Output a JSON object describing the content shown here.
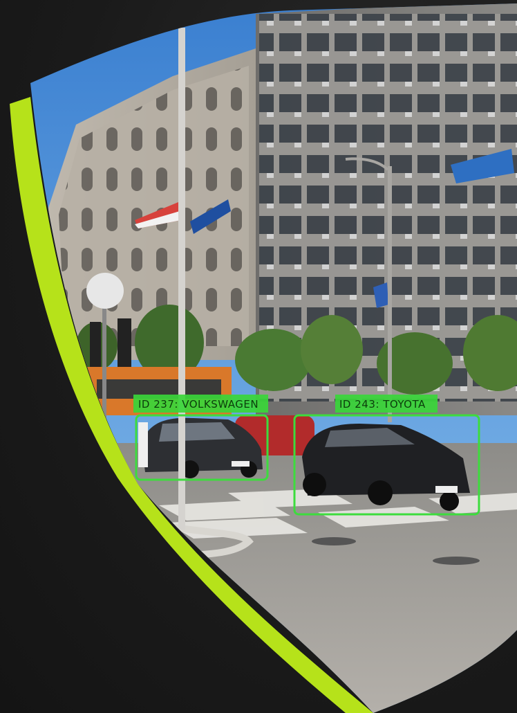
{
  "detections": [
    {
      "label": "ID 237: VOLKSWAGEN"
    },
    {
      "label": "ID 243: TOYOTA"
    }
  ],
  "colors": {
    "accent_stripe": "#b6e21a",
    "box_green": "#3ddc3d",
    "label_bg": "#39d639",
    "background": "#1c1c1c"
  }
}
